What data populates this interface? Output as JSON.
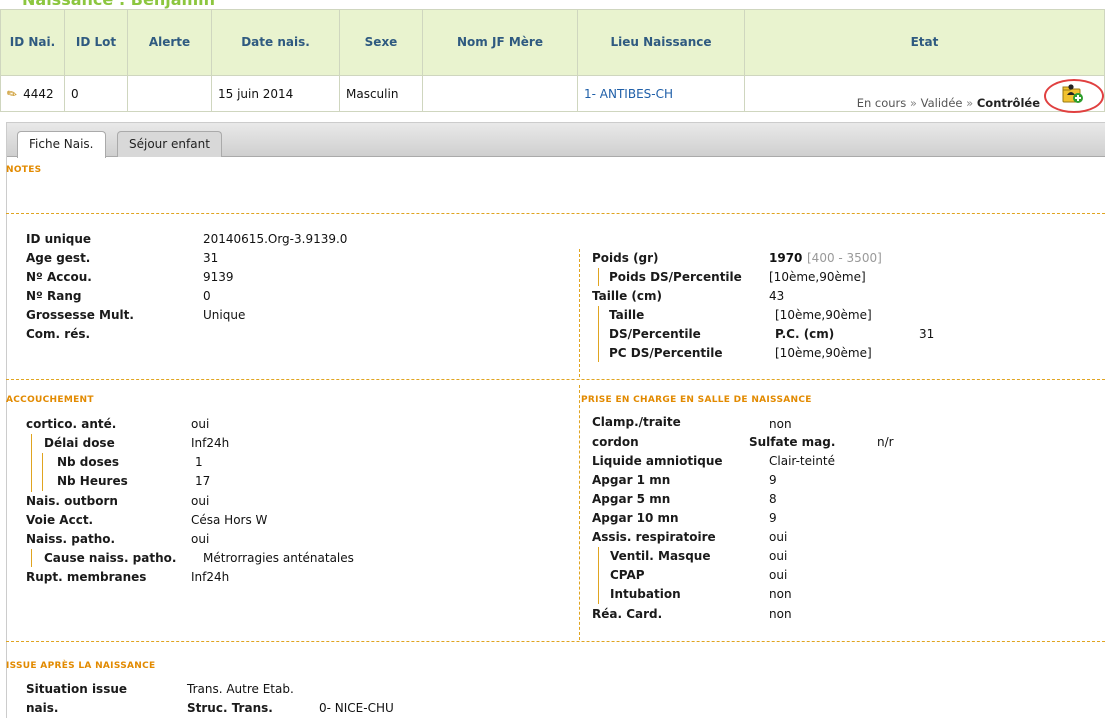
{
  "page_title": "Naissance : Benjamin",
  "table": {
    "headers": [
      "ID Nai.",
      "ID Lot",
      "Alerte",
      "Date nais.",
      "Sexe",
      "Nom JF Mère",
      "Lieu Naissance",
      "Etat"
    ],
    "row": {
      "id_nai": "4442",
      "id_lot": "0",
      "alerte": "",
      "date": "15 juin 2014",
      "sexe": "Masculin",
      "nom_jf": "",
      "lieu": "1- ANTIBES-CH",
      "etat_steps": [
        "En cours",
        "Validée",
        "Contrôlée"
      ],
      "etat_sep": "»"
    }
  },
  "tabs": [
    "Fiche Nais.",
    "Séjour enfant"
  ],
  "sections": {
    "notes": "Notes",
    "accouchement": "Accouchement",
    "prise_en_charge": "Prise en charge en salle de naissance",
    "issue": "Issue après la naissance"
  },
  "identity": {
    "id_unique_label": "ID unique",
    "id_unique": "20140615.Org-3.9139.0",
    "age_label": "Age gest.",
    "age": "31",
    "accou_label": "Nº Accou.",
    "accou": "9139",
    "rang_label": "Nº Rang",
    "rang": "0",
    "grossesse_label": "Grossesse Mult.",
    "grossesse": "Unique",
    "com_label": "Com. rés."
  },
  "measures": {
    "poids_label": "Poids (gr)",
    "poids": "1970",
    "poids_range": "[400 - 3500]",
    "poids_ds_label": "Poids DS/Percentile",
    "poids_ds": "[10ème,90ème]",
    "taille_label": "Taille (cm)",
    "taille": "43",
    "taille_sub_label": "Taille",
    "taille_sub": "[10ème,90ème]",
    "ds_label": "DS/Percentile",
    "pc_label": "P.C. (cm)",
    "pc": "31",
    "pc_ds_label": "PC DS/Percentile",
    "pc_ds": "[10ème,90ème]"
  },
  "accouchement": {
    "cortico_label": "cortico. anté.",
    "cortico": "oui",
    "delai_label": "Délai dose",
    "delai": "Inf24h",
    "nbdoses_label": "Nb doses",
    "nbdoses": "1",
    "nbheures_label": "Nb Heures",
    "nbheures": "17",
    "outborn_label": "Nais. outborn",
    "outborn": "oui",
    "voie_label": "Voie Acct.",
    "voie": "Césa Hors W",
    "patho_label": "Naiss. patho.",
    "patho": "oui",
    "cause_label": "Cause naiss. patho.",
    "cause": "Métrorragies anténatales",
    "rupt_label": "Rupt. membranes",
    "rupt": "Inf24h"
  },
  "prise": {
    "clamp_label": "Clamp./traite",
    "clamp": "non",
    "cordon_label": "cordon",
    "sulfate_label": "Sulfate mag.",
    "sulfate": "n/r",
    "liquide_label": "Liquide amniotique",
    "liquide": "Clair-teinté",
    "apgar1_label": "Apgar 1 mn",
    "apgar1": "9",
    "apgar5_label": "Apgar 5 mn",
    "apgar5": "8",
    "apgar10_label": "Apgar 10 mn",
    "apgar10": "9",
    "assis_label": "Assis. respiratoire",
    "assis": "oui",
    "ventil_label": "Ventil. Masque",
    "ventil": "oui",
    "cpap_label": "CPAP",
    "cpap": "oui",
    "intub_label": "Intubation",
    "intub": "non",
    "rea_label": "Réa. Card.",
    "rea": "non"
  },
  "issue": {
    "situation_label": "Situation issue",
    "situation": "Trans. Autre Etab.",
    "nais_label": "nais.",
    "struc_label": "Struc. Trans.",
    "struc": "0- NICE-CHU"
  }
}
